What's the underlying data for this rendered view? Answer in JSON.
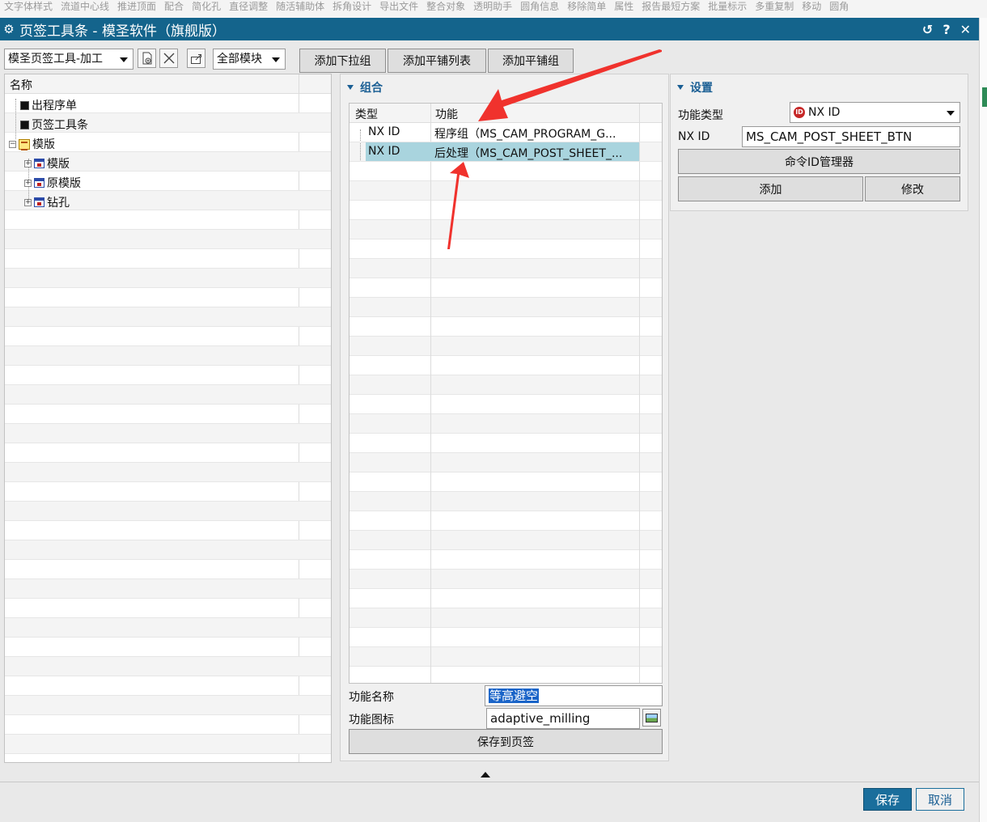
{
  "window": {
    "title": "页签工具条 - 模圣软件（旗舰版）",
    "controls": [
      "↺",
      "?",
      "✕"
    ]
  },
  "ribbon": [
    "文字体样式",
    "流道中心线",
    "推进顶面",
    "配合",
    "简化孔",
    "直径调整",
    "随活辅助体",
    "拆角设计",
    "导出文件",
    "整合对象",
    "透明助手",
    "圆角信息",
    "移除简单",
    "属性",
    "报告最短方案",
    "批量标示",
    "多重复制",
    "移动",
    "圆角"
  ],
  "toolbar": {
    "preset_combo": "模圣页签工具-加工",
    "module_combo": "全部模块",
    "add_dropdown_group": "添加下拉组",
    "add_tile_list": "添加平铺列表",
    "add_tile_group": "添加平铺组"
  },
  "tree": {
    "header": "名称",
    "items": [
      {
        "label": "出程序单"
      },
      {
        "label": "页签工具条"
      },
      {
        "label": "模版"
      },
      {
        "label": "模版"
      },
      {
        "label": "原模版"
      },
      {
        "label": "钻孔"
      }
    ]
  },
  "group": {
    "section_title": "组合",
    "columns": [
      "类型",
      "功能"
    ],
    "rows": [
      {
        "type": "NX ID",
        "func": "程序组（MS_CAM_PROGRAM_G..."
      },
      {
        "type": "NX ID",
        "func": "后处理（MS_CAM_POST_SHEET_..."
      }
    ],
    "func_name_label": "功能名称",
    "func_name_value": "等高避空",
    "func_icon_label": "功能图标",
    "func_icon_value": "adaptive_milling",
    "save_to_tab": "保存到页签"
  },
  "settings": {
    "section_title": "设置",
    "func_type_label": "功能类型",
    "func_type_value": "NX ID",
    "nxid_label": "NX ID",
    "nxid_value": "MS_CAM_POST_SHEET_BTN",
    "cmd_manager": "命令ID管理器",
    "add": "添加",
    "modify": "修改"
  },
  "footer": {
    "save": "保存",
    "cancel": "取消"
  },
  "colors": {
    "titlebar": "#14648c",
    "selection": "#a9d4de",
    "section": "#1b5f94",
    "annotation_arrow": "#f0322d"
  }
}
